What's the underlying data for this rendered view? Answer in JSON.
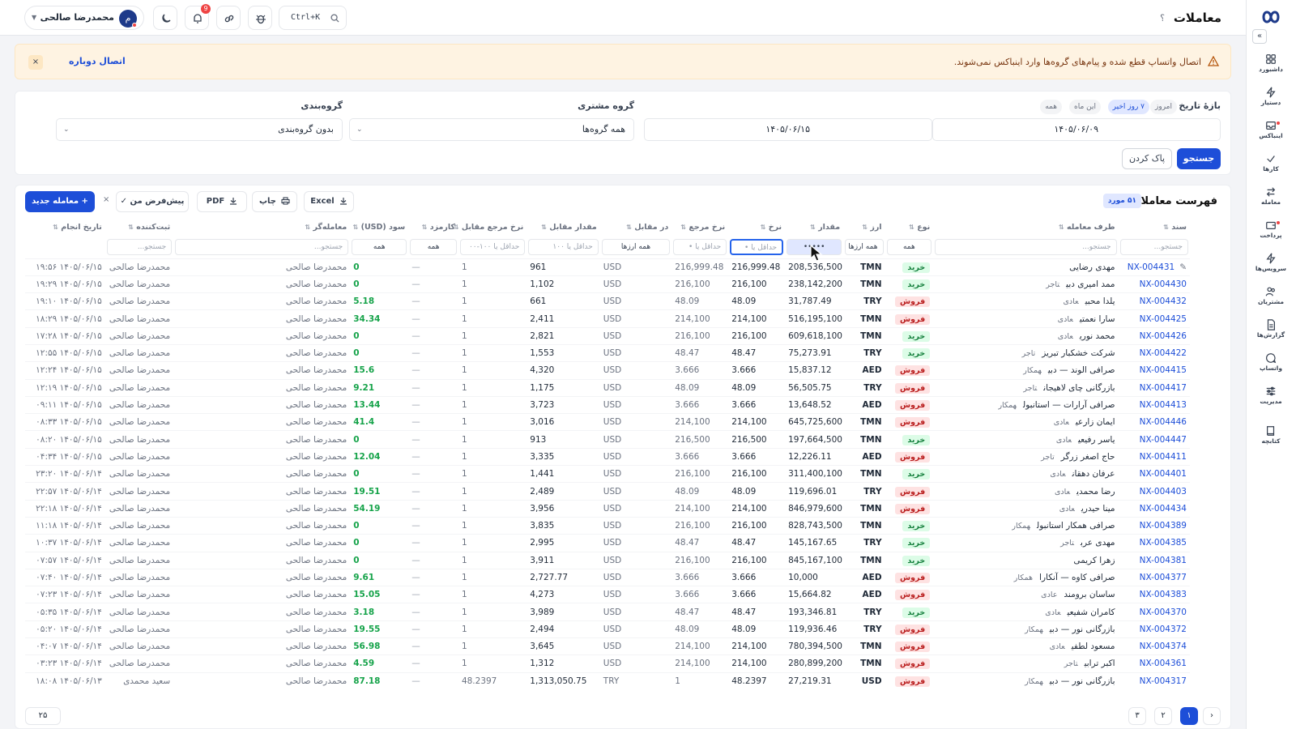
{
  "header": {
    "title": "معاملات",
    "help": "؟",
    "user_name": "محمدرضا صالحی",
    "user_initial": "م",
    "notifications_count": "9",
    "command_shortcut": "Ctrl+K"
  },
  "sidebar": {
    "items": [
      {
        "label": "داشبورد",
        "icon": "dashboard-icon"
      },
      {
        "label": "دستیار",
        "icon": "bolt-icon"
      },
      {
        "label": "اینباکس",
        "icon": "inbox-icon"
      },
      {
        "label": "کارها",
        "icon": "check-icon"
      },
      {
        "label": "معامله",
        "icon": "swap-icon"
      },
      {
        "label": "پرداخت",
        "icon": "wallet-icon"
      },
      {
        "label": "سرویس‌ها",
        "icon": "bolt-icon"
      },
      {
        "label": "مشتریان",
        "icon": "users-icon"
      },
      {
        "label": "گزارش‌ها",
        "icon": "report-icon"
      },
      {
        "label": "واتساپ",
        "icon": "chat-icon"
      },
      {
        "label": "مدیریت",
        "icon": "sliders-icon"
      },
      {
        "label": "کتابچه",
        "icon": "book-icon"
      }
    ]
  },
  "alert": {
    "message": "اتصال واتساپ قطع شده و پیام‌های گروه‌ها وارد اینباکس نمی‌شوند.",
    "action": "اتصال دوباره",
    "close": "×"
  },
  "filters": {
    "date_range_label": "بازهٔ تاریخ",
    "chips": [
      "امروز",
      "۷ روز اخیر",
      "این ماه",
      "همه"
    ],
    "date_from": "۱۴۰۵/۰۶/۰۹",
    "date_to": "۱۴۰۵/۰۶/۱۵",
    "customer_group_label": "گروه مشتری",
    "customer_group_value": "همه گروه‌ها",
    "grouping_label": "گروه‌بندی",
    "grouping_value": "بدون گروه‌بندی",
    "search_button": "جستجو",
    "clear_button": "پاک کردن"
  },
  "table": {
    "title": "فهرست معاملات",
    "count_badge": "۵۱ مورد",
    "new_button": "+ معامله جدید",
    "preset_button": "پیش‌فرض من ✓",
    "print_button": "چاپ",
    "pdf_button": "PDF",
    "excel_button": "Excel",
    "clear_x": "×",
    "columns": [
      "سند",
      "طرف معامله",
      "نوع",
      "ارز",
      "مقدار",
      "نرخ",
      "نرخ مرجع",
      "در مقابل",
      "مقدار مقابل",
      "نرخ مرجع مقابل",
      "کارمزد",
      "سود (USD)",
      "معامله‌گر",
      "ثبت‌کننده",
      "تاریخ انجام"
    ],
    "filter_row": {
      "doc": "جستجو...",
      "party": "جستجو...",
      "type": "همه",
      "currency": "همه ارزها",
      "amount": "•••••",
      "rate": "حداقل یا •",
      "ref_rate": "حداقل یا •",
      "counter": "همه ارزها",
      "counter_amount": "حداقل یا ۱۰۰",
      "counter_ref": "حداقل یا ۱۰۰-۰۰",
      "fee": "همه",
      "profit": "همه",
      "trader": "جستجو...",
      "recorder": "جستجو..."
    },
    "rows": [
      {
        "doc": "NX-004431",
        "party": "مهدی رضایی",
        "tag": "",
        "type": "خرید",
        "cur": "TMN",
        "amount": "208,536,500",
        "rate": "216,999.48",
        "ref": "216,999.48",
        "counter": "USD",
        "camount": "961",
        "cref": "1",
        "fee": "—",
        "profit": "0",
        "trader": "محمدرضا صالحی",
        "recorder": "محمدرضا صالحی",
        "date": "۱۴۰۵/۰۶/۱۵ ۱۹:۵۶"
      },
      {
        "doc": "NX-004430",
        "party": "ممد امیری دبی",
        "tag": "تاجر",
        "type": "خرید",
        "cur": "TMN",
        "amount": "238,142,200",
        "rate": "216,100",
        "ref": "216,100",
        "counter": "USD",
        "camount": "1,102",
        "cref": "1",
        "fee": "—",
        "profit": "0",
        "trader": "محمدرضا صالحی",
        "recorder": "محمدرضا صالحی",
        "date": "۱۴۰۵/۰۶/۱۵ ۱۹:۲۹"
      },
      {
        "doc": "NX-004432",
        "party": "یلدا محبی",
        "tag": "عادی",
        "type": "فروش",
        "cur": "TRY",
        "amount": "31,787.49",
        "rate": "48.09",
        "ref": "48.09",
        "counter": "USD",
        "camount": "661",
        "cref": "1",
        "fee": "—",
        "profit": "5.18",
        "trader": "محمدرضا صالحی",
        "recorder": "محمدرضا صالحی",
        "date": "۱۴۰۵/۰۶/۱۵ ۱۹:۱۰"
      },
      {
        "doc": "NX-004425",
        "party": "سارا نعمتی",
        "tag": "عادی",
        "type": "فروش",
        "cur": "TMN",
        "amount": "516,195,100",
        "rate": "214,100",
        "ref": "214,100",
        "counter": "USD",
        "camount": "2,411",
        "cref": "1",
        "fee": "—",
        "profit": "34.34",
        "trader": "محمدرضا صالحی",
        "recorder": "محمدرضا صالحی",
        "date": "۱۴۰۵/۰۶/۱۵ ۱۸:۲۹"
      },
      {
        "doc": "NX-004426",
        "party": "محمد نوری",
        "tag": "عادی",
        "type": "خرید",
        "cur": "TMN",
        "amount": "609,618,100",
        "rate": "216,100",
        "ref": "216,100",
        "counter": "USD",
        "camount": "2,821",
        "cref": "1",
        "fee": "—",
        "profit": "0",
        "trader": "محمدرضا صالحی",
        "recorder": "محمدرضا صالحی",
        "date": "۱۴۰۵/۰۶/۱۵ ۱۷:۲۸"
      },
      {
        "doc": "NX-004422",
        "party": "شرکت خشکبار تبریز",
        "tag": "تاجر",
        "type": "خرید",
        "cur": "TRY",
        "amount": "75,273.91",
        "rate": "48.47",
        "ref": "48.47",
        "counter": "USD",
        "camount": "1,553",
        "cref": "1",
        "fee": "—",
        "profit": "0",
        "trader": "محمدرضا صالحی",
        "recorder": "محمدرضا صالحی",
        "date": "۱۴۰۵/۰۶/۱۵ ۱۲:۵۵"
      },
      {
        "doc": "NX-004415",
        "party": "صرافی الوند — دبی",
        "tag": "همکار",
        "type": "فروش",
        "cur": "AED",
        "amount": "15,837.12",
        "rate": "3.666",
        "ref": "3.666",
        "counter": "USD",
        "camount": "4,320",
        "cref": "1",
        "fee": "—",
        "profit": "15.6",
        "trader": "محمدرضا صالحی",
        "recorder": "محمدرضا صالحی",
        "date": "۱۴۰۵/۰۶/۱۵ ۱۲:۲۴"
      },
      {
        "doc": "NX-004417",
        "party": "بازرگانی چای لاهیجان",
        "tag": "تاجر",
        "type": "فروش",
        "cur": "TRY",
        "amount": "56,505.75",
        "rate": "48.09",
        "ref": "48.09",
        "counter": "USD",
        "camount": "1,175",
        "cref": "1",
        "fee": "—",
        "profit": "9.21",
        "trader": "محمدرضا صالحی",
        "recorder": "محمدرضا صالحی",
        "date": "۱۴۰۵/۰۶/۱۵ ۱۲:۱۹"
      },
      {
        "doc": "NX-004413",
        "party": "صرافی آرارات — استانبول",
        "tag": "همکار",
        "type": "فروش",
        "cur": "AED",
        "amount": "13,648.52",
        "rate": "3.666",
        "ref": "3.666",
        "counter": "USD",
        "camount": "3,723",
        "cref": "1",
        "fee": "—",
        "profit": "13.44",
        "trader": "محمدرضا صالحی",
        "recorder": "محمدرضا صالحی",
        "date": "۱۴۰۵/۰۶/۱۵ ۰۹:۱۱"
      },
      {
        "doc": "NX-004446",
        "party": "ایمان زارعی",
        "tag": "عادی",
        "type": "فروش",
        "cur": "TMN",
        "amount": "645,725,600",
        "rate": "214,100",
        "ref": "214,100",
        "counter": "USD",
        "camount": "3,016",
        "cref": "1",
        "fee": "—",
        "profit": "41.4",
        "trader": "محمدرضا صالحی",
        "recorder": "محمدرضا صالحی",
        "date": "۱۴۰۵/۰۶/۱۵ ۰۸:۳۳"
      },
      {
        "doc": "NX-004447",
        "party": "یاسر رفیعی",
        "tag": "عادی",
        "type": "خرید",
        "cur": "TMN",
        "amount": "197,664,500",
        "rate": "216,500",
        "ref": "216,500",
        "counter": "USD",
        "camount": "913",
        "cref": "1",
        "fee": "—",
        "profit": "0",
        "trader": "محمدرضا صالحی",
        "recorder": "محمدرضا صالحی",
        "date": "۱۴۰۵/۰۶/۱۵ ۰۸:۲۰"
      },
      {
        "doc": "NX-004411",
        "party": "حاج اصغر زرگر",
        "tag": "تاجر",
        "type": "فروش",
        "cur": "AED",
        "amount": "12,226.11",
        "rate": "3.666",
        "ref": "3.666",
        "counter": "USD",
        "camount": "3,335",
        "cref": "1",
        "fee": "—",
        "profit": "12.04",
        "trader": "محمدرضا صالحی",
        "recorder": "محمدرضا صالحی",
        "date": "۱۴۰۵/۰۶/۱۵ ۰۴:۳۴"
      },
      {
        "doc": "NX-004401",
        "party": "عرفان دهقان",
        "tag": "عادی",
        "type": "خرید",
        "cur": "TMN",
        "amount": "311,400,100",
        "rate": "216,100",
        "ref": "216,100",
        "counter": "USD",
        "camount": "1,441",
        "cref": "1",
        "fee": "—",
        "profit": "0",
        "trader": "محمدرضا صالحی",
        "recorder": "محمدرضا صالحی",
        "date": "۱۴۰۵/۰۶/۱۴ ۲۳:۲۰"
      },
      {
        "doc": "NX-004403",
        "party": "رضا محمدی",
        "tag": "عادی",
        "type": "فروش",
        "cur": "TRY",
        "amount": "119,696.01",
        "rate": "48.09",
        "ref": "48.09",
        "counter": "USD",
        "camount": "2,489",
        "cref": "1",
        "fee": "—",
        "profit": "19.51",
        "trader": "محمدرضا صالحی",
        "recorder": "محمدرضا صالحی",
        "date": "۱۴۰۵/۰۶/۱۴ ۲۲:۵۷"
      },
      {
        "doc": "NX-004434",
        "party": "مینا حیدری",
        "tag": "عادی",
        "type": "فروش",
        "cur": "TMN",
        "amount": "846,979,600",
        "rate": "214,100",
        "ref": "214,100",
        "counter": "USD",
        "camount": "3,956",
        "cref": "1",
        "fee": "—",
        "profit": "54.19",
        "trader": "محمدرضا صالحی",
        "recorder": "محمدرضا صالحی",
        "date": "۱۴۰۵/۰۶/۱۴ ۲۲:۱۸"
      },
      {
        "doc": "NX-004389",
        "party": "صرافی همکار استانبول",
        "tag": "همکار",
        "type": "خرید",
        "cur": "TMN",
        "amount": "828,743,500",
        "rate": "216,100",
        "ref": "216,100",
        "counter": "USD",
        "camount": "3,835",
        "cref": "1",
        "fee": "—",
        "profit": "0",
        "trader": "محمدرضا صالحی",
        "recorder": "محمدرضا صالحی",
        "date": "۱۴۰۵/۰۶/۱۴ ۱۱:۱۸"
      },
      {
        "doc": "NX-004385",
        "party": "مهدی عرب",
        "tag": "تاجر",
        "type": "خرید",
        "cur": "TRY",
        "amount": "145,167.65",
        "rate": "48.47",
        "ref": "48.47",
        "counter": "USD",
        "camount": "2,995",
        "cref": "1",
        "fee": "—",
        "profit": "0",
        "trader": "محمدرضا صالحی",
        "recorder": "محمدرضا صالحی",
        "date": "۱۴۰۵/۰۶/۱۴ ۱۰:۳۷"
      },
      {
        "doc": "NX-004381",
        "party": "زهرا کریمی",
        "tag": "",
        "type": "خرید",
        "cur": "TMN",
        "amount": "845,167,100",
        "rate": "216,100",
        "ref": "216,100",
        "counter": "USD",
        "camount": "3,911",
        "cref": "1",
        "fee": "—",
        "profit": "0",
        "trader": "محمدرضا صالحی",
        "recorder": "محمدرضا صالحی",
        "date": "۱۴۰۵/۰۶/۱۴ ۰۷:۵۷"
      },
      {
        "doc": "NX-004377",
        "party": "صرافی کاوه — آنکارا",
        "tag": "همکار",
        "type": "فروش",
        "cur": "AED",
        "amount": "10,000",
        "rate": "3.666",
        "ref": "3.666",
        "counter": "USD",
        "camount": "2,727.77",
        "cref": "1",
        "fee": "—",
        "profit": "9.61",
        "trader": "محمدرضا صالحی",
        "recorder": "محمدرضا صالحی",
        "date": "۱۴۰۵/۰۶/۱۴ ۰۷:۴۰"
      },
      {
        "doc": "NX-004383",
        "party": "ساسان برومند",
        "tag": "عادی",
        "type": "فروش",
        "cur": "AED",
        "amount": "15,664.82",
        "rate": "3.666",
        "ref": "3.666",
        "counter": "USD",
        "camount": "4,273",
        "cref": "1",
        "fee": "—",
        "profit": "15.05",
        "trader": "محمدرضا صالحی",
        "recorder": "محمدرضا صالحی",
        "date": "۱۴۰۵/۰۶/۱۴ ۰۷:۲۳"
      },
      {
        "doc": "NX-004370",
        "party": "کامران شفیعی",
        "tag": "عادی",
        "type": "خرید",
        "cur": "TRY",
        "amount": "193,346.81",
        "rate": "48.47",
        "ref": "48.47",
        "counter": "USD",
        "camount": "3,989",
        "cref": "1",
        "fee": "—",
        "profit": "3.18",
        "trader": "محمدرضا صالحی",
        "recorder": "محمدرضا صالحی",
        "date": "۱۴۰۵/۰۶/۱۴ ۰۵:۳۵"
      },
      {
        "doc": "NX-004372",
        "party": "بازرگانی نور — دبی",
        "tag": "همکار",
        "type": "فروش",
        "cur": "TRY",
        "amount": "119,936.46",
        "rate": "48.09",
        "ref": "48.09",
        "counter": "USD",
        "camount": "2,494",
        "cref": "1",
        "fee": "—",
        "profit": "19.55",
        "trader": "محمدرضا صالحی",
        "recorder": "محمدرضا صالحی",
        "date": "۱۴۰۵/۰۶/۱۴ ۰۵:۲۰"
      },
      {
        "doc": "NX-004374",
        "party": "مسعود لطفی",
        "tag": "عادی",
        "type": "فروش",
        "cur": "TMN",
        "amount": "780,394,500",
        "rate": "214,100",
        "ref": "214,100",
        "counter": "USD",
        "camount": "3,645",
        "cref": "1",
        "fee": "—",
        "profit": "56.98",
        "trader": "محمدرضا صالحی",
        "recorder": "محمدرضا صالحی",
        "date": "۱۴۰۵/۰۶/۱۴ ۰۴:۰۷"
      },
      {
        "doc": "NX-004361",
        "party": "اکبر ترابی",
        "tag": "تاجر",
        "type": "فروش",
        "cur": "TMN",
        "amount": "280,899,200",
        "rate": "214,100",
        "ref": "214,100",
        "counter": "USD",
        "camount": "1,312",
        "cref": "1",
        "fee": "—",
        "profit": "4.59",
        "trader": "محمدرضا صالحی",
        "recorder": "محمدرضا صالحی",
        "date": "۱۴۰۵/۰۶/۱۴ ۰۳:۲۳"
      },
      {
        "doc": "NX-004317",
        "party": "بازرگانی نور — دبی",
        "tag": "همکار",
        "type": "فروش",
        "cur": "USD",
        "amount": "27,219.31",
        "rate": "48.2397",
        "ref": "1",
        "counter": "TRY",
        "camount": "1,313,050.75",
        "cref": "48.2397",
        "fee": "—",
        "profit": "87.18",
        "trader": "محمدرضا صالحی",
        "recorder": "سعید محمدی",
        "date": "۱۴۰۵/۰۶/۱۳ ۱۸:۰۸"
      }
    ]
  },
  "pager": {
    "pages": [
      "۱",
      "۲",
      "۳"
    ],
    "page_size": "۲۵"
  },
  "colors": {
    "primary": "#1d4ed8",
    "buy_bg": "#dcfce7",
    "sell_bg": "#fee2e2",
    "profit": "#16a34a",
    "alert_bg": "#fef3e2"
  }
}
